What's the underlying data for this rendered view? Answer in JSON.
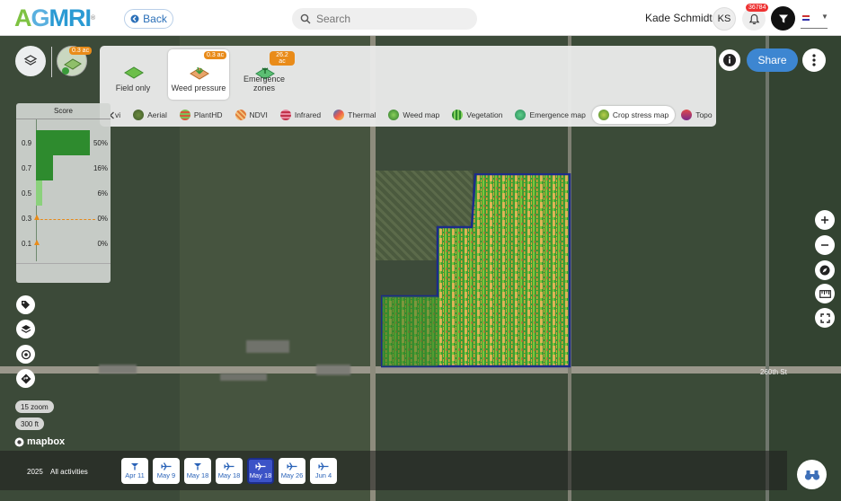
{
  "header": {
    "logo": {
      "a": "A",
      "g": "G",
      "rest": "MRI",
      "mark": "®"
    },
    "back_label": "Back",
    "search_placeholder": "Search",
    "user_name": "Kade Schmidt",
    "user_initials": "KS",
    "notification_count": "36784",
    "filter_icon": "filter-icon"
  },
  "field_thumb": {
    "badge": "0.3 ac"
  },
  "products": [
    {
      "label": "Field only",
      "badge": ""
    },
    {
      "label": "Weed pressure",
      "badge": "0.3 ac",
      "active": true
    },
    {
      "label": "Emergence zones",
      "badge": "26.2 ac"
    }
  ],
  "tabs": [
    {
      "label": "vi"
    },
    {
      "label": "Aerial"
    },
    {
      "label": "PlantHD"
    },
    {
      "label": "NDVI"
    },
    {
      "label": "Infrared"
    },
    {
      "label": "Thermal"
    },
    {
      "label": "Weed map"
    },
    {
      "label": "Vegetation"
    },
    {
      "label": "Emergence map"
    },
    {
      "label": "Crop stress map",
      "active": true
    },
    {
      "label": "Topo"
    }
  ],
  "actions": {
    "share_label": "Share"
  },
  "score": {
    "title": "Score",
    "rows": [
      {
        "label": "0.9",
        "percent": "50%",
        "fraction": 0.5
      },
      {
        "label": "0.7",
        "percent": "16%",
        "fraction": 0.16
      },
      {
        "label": "0.5",
        "percent": "6%",
        "fraction": 0.06
      },
      {
        "label": "0.3",
        "percent": "0%",
        "fraction": 0.0
      },
      {
        "label": "0.1",
        "percent": "0%",
        "fraction": 0.0
      }
    ]
  },
  "map": {
    "zoom_label": "15 zoom",
    "scale_label": "300 ft",
    "attribution": "mapbox",
    "street_label": "260th St"
  },
  "timeline": {
    "year": "2025",
    "scope": "All activities",
    "dates": [
      {
        "label": "Apr 11",
        "icon": "satellite-icon"
      },
      {
        "label": "May 9",
        "icon": "plane-icon"
      },
      {
        "label": "May 18",
        "icon": "satellite-icon"
      },
      {
        "label": "May 18",
        "icon": "plane-icon"
      },
      {
        "label": "May 18",
        "icon": "plane-icon",
        "active": true
      },
      {
        "label": "May 26",
        "icon": "plane-icon"
      },
      {
        "label": "Jun 4",
        "icon": "plane-icon"
      }
    ]
  },
  "colors": {
    "accent": "#3d86d1",
    "badge": "#e98b19",
    "score_high": "#2e8b2e",
    "score_mid": "#4caf50",
    "score_low": "#8bd17c",
    "active_date": "#3c53c7"
  }
}
